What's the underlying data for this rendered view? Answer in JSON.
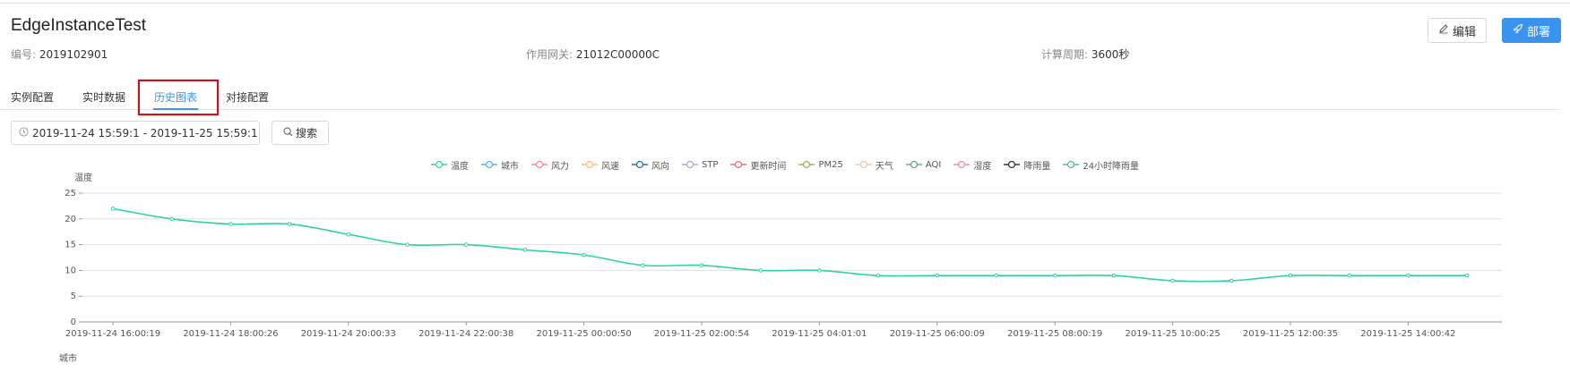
{
  "header": {
    "title": "EdgeInstanceTest",
    "fields": [
      {
        "label": "编号:",
        "value": "2019102901"
      },
      {
        "label": "作用网关:",
        "value": "21012C00000C"
      },
      {
        "label": "计算周期:",
        "value": "3600秒"
      }
    ],
    "edit_label": "编辑",
    "deploy_label": "部署"
  },
  "tabs": [
    {
      "label": "实例配置",
      "active": false
    },
    {
      "label": "实时数据",
      "active": false
    },
    {
      "label": "历史图表",
      "active": true
    },
    {
      "label": "对接配置",
      "active": false
    }
  ],
  "filter": {
    "date_range": "2019-11-24 15:59:1 - 2019-11-25 15:59:1",
    "search_label": "搜索"
  },
  "colors": {
    "accent": "#3a93ee",
    "line": "#2ed2a6",
    "highlight": "#c0161b"
  },
  "legend": [
    {
      "name": "温度",
      "color": "#2ed2a6"
    },
    {
      "name": "城市",
      "color": "#5ab1ef"
    },
    {
      "name": "风力",
      "color": "#f58a8a"
    },
    {
      "name": "风速",
      "color": "#ffb980"
    },
    {
      "name": "风向",
      "color": "#2c6ea4"
    },
    {
      "name": "STP",
      "color": "#b6a2de"
    },
    {
      "name": "更新时间",
      "color": "#e57373"
    },
    {
      "name": "PM25",
      "color": "#97b552"
    },
    {
      "name": "天气",
      "color": "#f2c6a0"
    },
    {
      "name": "AQI",
      "color": "#6aa88e"
    },
    {
      "name": "湿度",
      "color": "#e88fa5"
    },
    {
      "name": "降雨量",
      "color": "#333333"
    },
    {
      "name": "24小时降雨量",
      "color": "#5fb3a8"
    }
  ],
  "chart_data": {
    "type": "line",
    "ylabel": "温度",
    "ylim": [
      0,
      25
    ],
    "yticks": [
      0,
      5,
      10,
      15,
      20,
      25
    ],
    "xtick_labels": [
      "2019-11-24 16:00:19",
      "2019-11-24 18:00:26",
      "2019-11-24 20:00:33",
      "2019-11-24 22:00:38",
      "2019-11-25 00:00:50",
      "2019-11-25 02:00:54",
      "2019-11-25 04:01:01",
      "2019-11-25 06:00:09",
      "2019-11-25 08:00:19",
      "2019-11-25 10:00:25",
      "2019-11-25 12:00:35",
      "2019-11-25 14:00:42"
    ],
    "grid": true,
    "legend_position": "top",
    "series": [
      {
        "name": "温度",
        "values": [
          22,
          20,
          19,
          19,
          17,
          15,
          15,
          14,
          13,
          11,
          11,
          10,
          10,
          9,
          9,
          9,
          9,
          9,
          8,
          8,
          9,
          9,
          9,
          9
        ]
      }
    ],
    "next_axis_label": "城市"
  }
}
